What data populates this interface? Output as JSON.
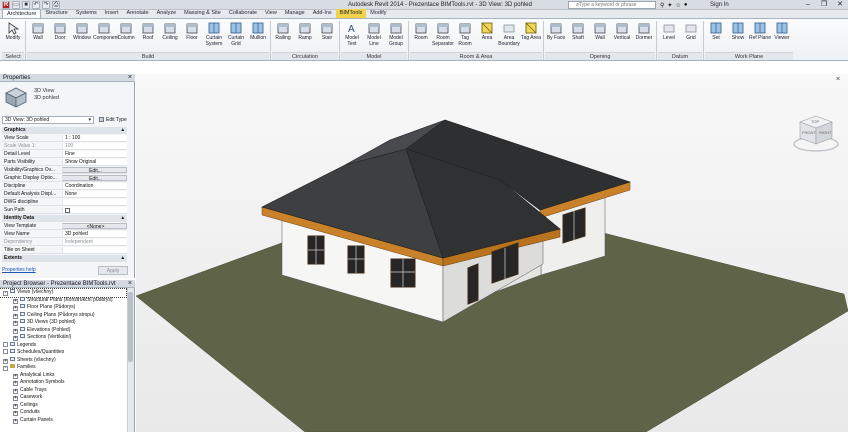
{
  "app_title": "Autodesk Revit 2014 -   Prezentace BIMTools.rvt - 3D View: 3D pohled",
  "search_placeholder": "Type a keyword or phrase",
  "signin": "Sign In",
  "qat_icons": [
    "revit-logo-icon",
    "open-icon",
    "save-icon",
    "undo-icon",
    "redo-icon",
    "print-icon"
  ],
  "tabs": [
    "Architecture",
    "Structure",
    "Systems",
    "Insert",
    "Annotate",
    "Analyze",
    "Massing & Site",
    "Collaborate",
    "View",
    "Manage",
    "Add-Ins",
    "BIMTools",
    "Modify"
  ],
  "active_tab": "Architecture",
  "ribbon": {
    "modify": "Modify",
    "select": "Select",
    "build": [
      "Wall",
      "Door",
      "Window",
      "Component",
      "Column",
      "Roof",
      "Ceiling",
      "Floor",
      "Curtain System",
      "Curtain Grid",
      "Mullion"
    ],
    "circulation": [
      "Railing",
      "Ramp",
      "Stair"
    ],
    "model": [
      "Model Text",
      "Model Line",
      "Model Group"
    ],
    "room_area": [
      "Room",
      "Room Separator",
      "Tag Room",
      "Area",
      "Area Boundary",
      "Tag Area"
    ],
    "opening": [
      "By Face",
      "Shaft",
      "Wall",
      "Vertical",
      "Dormer"
    ],
    "datum": [
      "Level",
      "Grid"
    ],
    "work_plane": [
      "Set",
      "Show",
      "Ref Plane",
      "Viewer"
    ],
    "groups": [
      "Select",
      "Build",
      "Circulation",
      "Model",
      "Room & Area",
      "Opening",
      "Datum",
      "Work Plane"
    ]
  },
  "properties": {
    "title": "Properties",
    "type_name": "3D View",
    "type_sub": "3D pohled",
    "selector": "3D View: 3D pohled",
    "edit_type": "Edit Type",
    "rows": [
      {
        "k": "Graphics",
        "v": "",
        "sec": true
      },
      {
        "k": "View Scale",
        "v": "1 : 100"
      },
      {
        "k": "Scale Value    1:",
        "v": "100",
        "dis": true
      },
      {
        "k": "Detail Level",
        "v": "Fine"
      },
      {
        "k": "Parts Visibility",
        "v": "Show Original"
      },
      {
        "k": "Visibility/Graphics Ov...",
        "v": "Edit...",
        "btn": true
      },
      {
        "k": "Graphic Display Optio...",
        "v": "Edit...",
        "btn": true
      },
      {
        "k": "Discipline",
        "v": "Coordination"
      },
      {
        "k": "Default Analysis Displ...",
        "v": "None"
      },
      {
        "k": "DWG discipline",
        "v": ""
      },
      {
        "k": "Sun Path",
        "v": ""
      },
      {
        "k": "Identity Data",
        "v": "",
        "sec": true
      },
      {
        "k": "View Template",
        "v": "<None>",
        "btn": true
      },
      {
        "k": "View Name",
        "v": "3D pohled"
      },
      {
        "k": "Dependency",
        "v": "Independent",
        "dis": true
      },
      {
        "k": "Title on Sheet",
        "v": ""
      },
      {
        "k": "Extents",
        "v": "",
        "sec": true
      }
    ],
    "help": "Properties help",
    "apply": "Apply"
  },
  "browser": {
    "title": "Project Browser - Prezentace BIMTools.rvt",
    "items": [
      {
        "t": "Views (všechny)",
        "lvl": 0,
        "ex": "-",
        "kind": "vi",
        "sel": true
      },
      {
        "t": "Structural Plans (Konstrukční půdorys)",
        "lvl": 1,
        "ex": "+",
        "kind": "vi"
      },
      {
        "t": "Floor Plans (Půdorys)",
        "lvl": 1,
        "ex": "+",
        "kind": "vi"
      },
      {
        "t": "Ceiling Plans (Půdorys stropu)",
        "lvl": 1,
        "ex": "+",
        "kind": "vi"
      },
      {
        "t": "3D Views (3D pohled)",
        "lvl": 1,
        "ex": "+",
        "kind": "vi"
      },
      {
        "t": "Elevations (Pohled)",
        "lvl": 1,
        "ex": "+",
        "kind": "vi"
      },
      {
        "t": "Sections (Vertikální)",
        "lvl": 1,
        "ex": "+",
        "kind": "vi"
      },
      {
        "t": "Legends",
        "lvl": 0,
        "ex": "",
        "kind": "vi"
      },
      {
        "t": "Schedules/Quantities",
        "lvl": 0,
        "ex": "",
        "kind": "vi"
      },
      {
        "t": "Sheets (všechny)",
        "lvl": 0,
        "ex": "+",
        "kind": "vi"
      },
      {
        "t": "Families",
        "lvl": 0,
        "ex": "-",
        "kind": "fi"
      },
      {
        "t": "Analytical Links",
        "lvl": 1,
        "ex": "+",
        "kind": ""
      },
      {
        "t": "Annotation Symbols",
        "lvl": 1,
        "ex": "+",
        "kind": ""
      },
      {
        "t": "Cable Trays",
        "lvl": 1,
        "ex": "+",
        "kind": ""
      },
      {
        "t": "Casework",
        "lvl": 1,
        "ex": "+",
        "kind": ""
      },
      {
        "t": "Ceilings",
        "lvl": 1,
        "ex": "+",
        "kind": ""
      },
      {
        "t": "Conduits",
        "lvl": 1,
        "ex": "+",
        "kind": ""
      },
      {
        "t": "Curtain Panels",
        "lvl": 1,
        "ex": "+",
        "kind": ""
      }
    ]
  },
  "viewcube": {
    "top": "TOP",
    "front": "FRONT",
    "right": "RIGHT"
  }
}
